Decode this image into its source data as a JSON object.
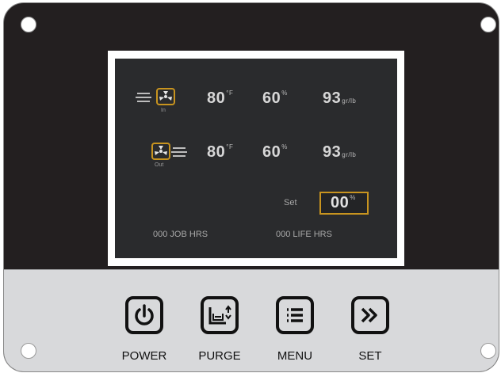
{
  "display": {
    "row1": {
      "fan_label": "In",
      "temp": "80",
      "temp_unit": "°F",
      "humidity": "60",
      "humidity_unit": "%",
      "flow": "93",
      "flow_unit": "gr/lb"
    },
    "row2": {
      "fan_label": "Out",
      "temp": "80",
      "temp_unit": "°F",
      "humidity": "60",
      "humidity_unit": "%",
      "flow": "93",
      "flow_unit": "gr/lb"
    },
    "set": {
      "label": "Set",
      "value": "00",
      "unit": "%"
    },
    "job_hours": {
      "value": "000",
      "label": "JOB HRS"
    },
    "life_hours": {
      "value": "000",
      "label": "LIFE HRS"
    }
  },
  "buttons": [
    {
      "label": "POWER",
      "icon": "power-icon"
    },
    {
      "label": "PURGE",
      "icon": "purge-icon"
    },
    {
      "label": "MENU",
      "icon": "menu-icon"
    },
    {
      "label": "SET",
      "icon": "chevron-double-right-icon"
    }
  ],
  "colors": {
    "panel_dark": "#231f20",
    "panel_light": "#d8d9db",
    "accent": "#c8941f",
    "screen": "#2a2b2d"
  }
}
